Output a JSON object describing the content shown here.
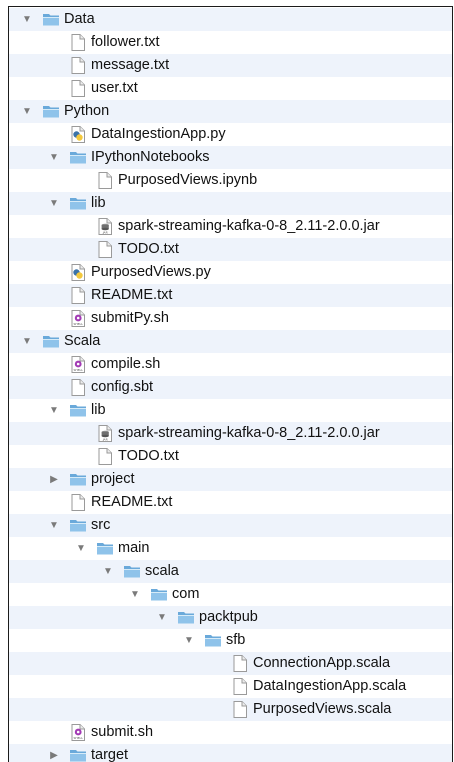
{
  "tree": [
    {
      "name": "Data",
      "depth": 0,
      "type": "folder",
      "expanded": true
    },
    {
      "name": "follower.txt",
      "depth": 1,
      "type": "file"
    },
    {
      "name": "message.txt",
      "depth": 1,
      "type": "file"
    },
    {
      "name": "user.txt",
      "depth": 1,
      "type": "file"
    },
    {
      "name": "Python",
      "depth": 0,
      "type": "folder",
      "expanded": true
    },
    {
      "name": "DataIngestionApp.py",
      "depth": 1,
      "type": "python"
    },
    {
      "name": "IPythonNotebooks",
      "depth": 1,
      "type": "folder",
      "expanded": true
    },
    {
      "name": "PurposedViews.ipynb",
      "depth": 2,
      "type": "file"
    },
    {
      "name": "lib",
      "depth": 1,
      "type": "folder",
      "expanded": true
    },
    {
      "name": "spark-streaming-kafka-0-8_2.11-2.0.0.jar",
      "depth": 2,
      "type": "jar"
    },
    {
      "name": "TODO.txt",
      "depth": 2,
      "type": "file"
    },
    {
      "name": "PurposedViews.py",
      "depth": 1,
      "type": "python"
    },
    {
      "name": "README.txt",
      "depth": 1,
      "type": "file"
    },
    {
      "name": "submitPy.sh",
      "depth": 1,
      "type": "shell"
    },
    {
      "name": "Scala",
      "depth": 0,
      "type": "folder",
      "expanded": true
    },
    {
      "name": "compile.sh",
      "depth": 1,
      "type": "shell"
    },
    {
      "name": "config.sbt",
      "depth": 1,
      "type": "file"
    },
    {
      "name": "lib",
      "depth": 1,
      "type": "folder",
      "expanded": true
    },
    {
      "name": "spark-streaming-kafka-0-8_2.11-2.0.0.jar",
      "depth": 2,
      "type": "jar"
    },
    {
      "name": "TODO.txt",
      "depth": 2,
      "type": "file"
    },
    {
      "name": "project",
      "depth": 1,
      "type": "folder",
      "expanded": false
    },
    {
      "name": "README.txt",
      "depth": 1,
      "type": "file"
    },
    {
      "name": "src",
      "depth": 1,
      "type": "folder",
      "expanded": true
    },
    {
      "name": "main",
      "depth": 2,
      "type": "folder",
      "expanded": true
    },
    {
      "name": "scala",
      "depth": 3,
      "type": "folder",
      "expanded": true
    },
    {
      "name": "com",
      "depth": 4,
      "type": "folder",
      "expanded": true
    },
    {
      "name": "packtpub",
      "depth": 5,
      "type": "folder",
      "expanded": true
    },
    {
      "name": "sfb",
      "depth": 6,
      "type": "folder",
      "expanded": true
    },
    {
      "name": "ConnectionApp.scala",
      "depth": 7,
      "type": "file"
    },
    {
      "name": "DataIngestionApp.scala",
      "depth": 7,
      "type": "file"
    },
    {
      "name": "PurposedViews.scala",
      "depth": 7,
      "type": "file"
    },
    {
      "name": "submit.sh",
      "depth": 1,
      "type": "shell"
    },
    {
      "name": "target",
      "depth": 1,
      "type": "folder",
      "expanded": false
    }
  ],
  "icon_labels": {
    "shell": "SHELL",
    "jar": "JAR"
  },
  "colors": {
    "folder_front": "#8fc3ea",
    "folder_back": "#6aa9da",
    "alt_row": "#eef3fb",
    "python_blue": "#3b73a8",
    "python_yellow": "#f4c93d",
    "shell_purple": "#a33bb5"
  }
}
